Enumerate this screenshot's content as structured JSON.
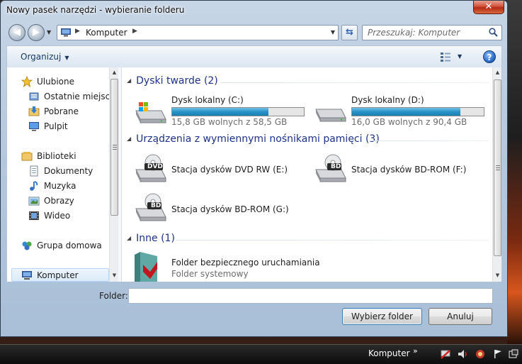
{
  "window": {
    "title": "Nowy pasek narzędzi - wybieranie folderu",
    "close_glyph": "✕"
  },
  "navbar": {
    "back_glyph": "◀",
    "forward_glyph": "▶",
    "address_path": "Komputer",
    "search_placeholder": "Przeszukaj: Komputer",
    "refresh_glyph": "⇆"
  },
  "toolbar": {
    "organize_label": "Organizuj",
    "help_glyph": "?"
  },
  "sidebar": {
    "items": [
      {
        "label": "Ulubione",
        "icon": "star-icon"
      },
      {
        "label": "Ostatnie miejsca",
        "icon": "recent-places-icon"
      },
      {
        "label": "Pobrane",
        "icon": "downloads-icon"
      },
      {
        "label": "Pulpit",
        "icon": "desktop-icon"
      },
      {
        "label": "Biblioteki",
        "icon": "libraries-icon"
      },
      {
        "label": "Dokumenty",
        "icon": "documents-icon"
      },
      {
        "label": "Muzyka",
        "icon": "music-icon"
      },
      {
        "label": "Obrazy",
        "icon": "pictures-icon"
      },
      {
        "label": "Wideo",
        "icon": "video-icon"
      },
      {
        "label": "Grupa domowa",
        "icon": "homegroup-icon"
      },
      {
        "label": "Komputer",
        "icon": "computer-icon"
      }
    ]
  },
  "main": {
    "groups": [
      {
        "title": "Dyski twarde (2)"
      },
      {
        "title": "Urządzenia z wymiennymi nośnikami pamięci (3)"
      },
      {
        "title": "Inne (1)"
      }
    ],
    "drives": [
      {
        "name": "Dysk lokalny (C:)",
        "free_text": "15,8 GB wolnych z 58,5 GB",
        "used_fraction": 0.73
      },
      {
        "name": "Dysk lokalny (D:)",
        "free_text": "16,0 GB wolnych z 90,4 GB",
        "used_fraction": 0.82
      }
    ],
    "removable": [
      {
        "name": "Stacja dysków DVD RW (E:)",
        "badge": "DVD"
      },
      {
        "name": "Stacja dysków BD-ROM (F:)",
        "badge": "BD"
      },
      {
        "name": "Stacja dysków BD-ROM (G:)",
        "badge": "BD"
      }
    ],
    "other": [
      {
        "name": "Folder bezpiecznego uruchamiania",
        "sub": "Folder systemowy"
      }
    ]
  },
  "bottom": {
    "folder_label": "Folder:",
    "folder_value": "",
    "select_button": "Wybierz folder",
    "cancel_button": "Anuluj"
  },
  "taskbar": {
    "label": "Komputer",
    "chevron": "»"
  }
}
